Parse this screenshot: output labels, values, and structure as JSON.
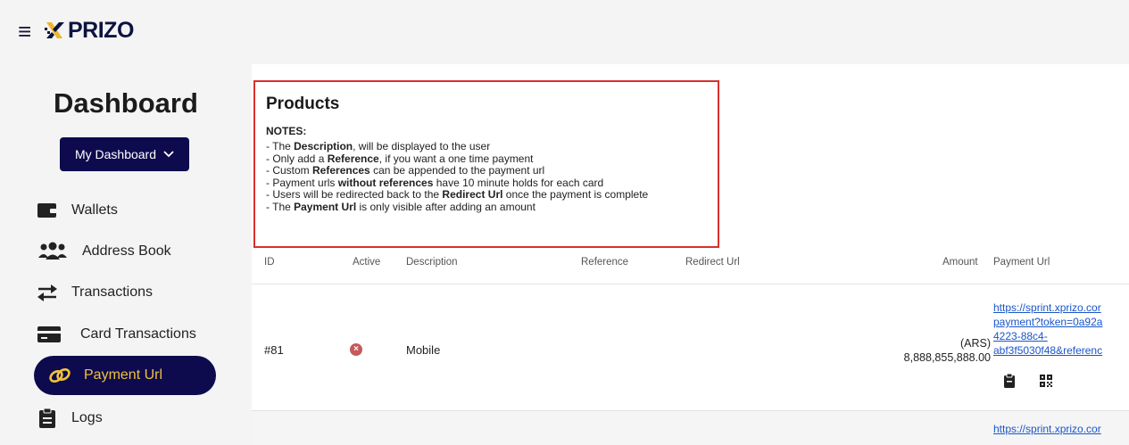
{
  "header": {
    "menu_icon": "hamburger-icon",
    "logo_text": "PRIZO",
    "logo_icon": "xprizo-x-icon"
  },
  "sidebar": {
    "title": "Dashboard",
    "dashboard_button": "My Dashboard",
    "items": [
      {
        "label": "Wallets",
        "icon": "wallet-icon"
      },
      {
        "label": "Address Book",
        "icon": "users-icon"
      },
      {
        "label": "Transactions",
        "icon": "swap-arrows-icon"
      },
      {
        "label": "Card Transactions",
        "icon": "credit-card-icon"
      },
      {
        "label": "Payment Url",
        "icon": "link-icon",
        "active": true
      },
      {
        "label": "Logs",
        "icon": "clipboard-icon"
      }
    ]
  },
  "products": {
    "title": "Products",
    "notes_heading": "NOTES:",
    "notes": [
      {
        "pre": "- The ",
        "bold": "Description",
        "post": ", will be displayed to the user"
      },
      {
        "pre": "- Only add a ",
        "bold": "Reference",
        "post": ", if you want a one time payment"
      },
      {
        "pre": "- Custom ",
        "bold": "References",
        "post": " can be appended to the payment url"
      },
      {
        "pre": "- Payment urls ",
        "bold": "without references",
        "post": " have 10 minute holds for each card"
      },
      {
        "pre": "- Users will be redirected back to the ",
        "bold": "Redirect Url",
        "post": " once the payment is complete"
      },
      {
        "pre": "- The ",
        "bold": "Payment Url",
        "post": " is only visible after adding an amount"
      }
    ]
  },
  "table": {
    "columns": [
      "ID",
      "Active",
      "Description",
      "Reference",
      "Redirect Url",
      "Amount",
      "Payment Url"
    ],
    "rows": [
      {
        "id": "#81",
        "active": false,
        "description": "Mobile",
        "reference": "",
        "redirect_url": "",
        "currency": "(ARS)",
        "amount": "8,888,855,888.00",
        "payment_url_lines": [
          "https://sprint.xprizo.cor",
          "payment?token=0a92a",
          "4223-88c4-",
          "abf3f5030f48&referenc"
        ]
      },
      {
        "payment_url_lines": [
          "https://sprint.xprizo.cor"
        ]
      }
    ]
  },
  "colors": {
    "brand_navy": "#0d0b4d",
    "accent_yellow": "#f0c23b",
    "highlight_red": "#d9302c",
    "link_blue": "#1a55c8"
  }
}
